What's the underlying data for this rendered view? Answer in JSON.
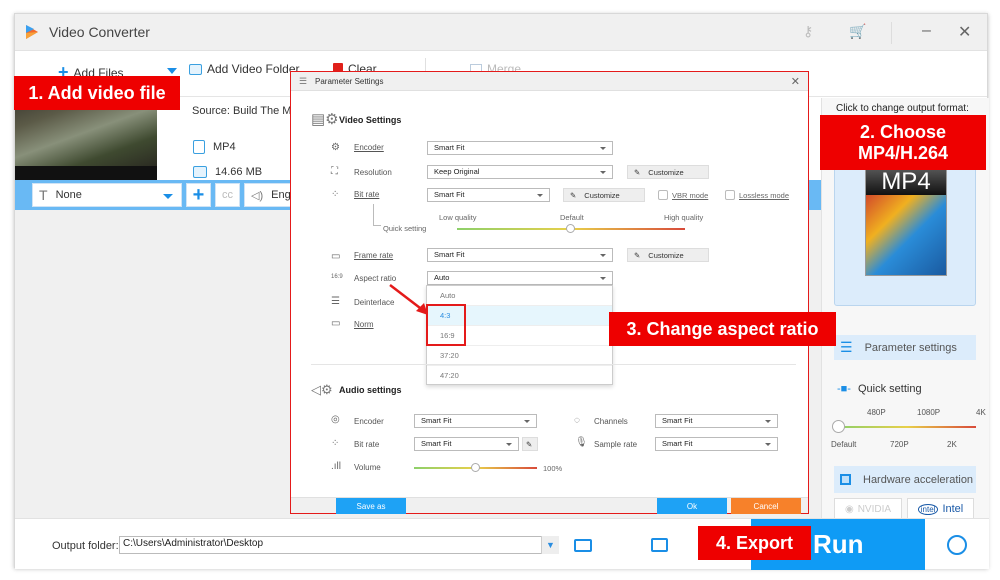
{
  "app": {
    "title": "Video Converter"
  },
  "toolbar": {
    "add_files": "Add Files",
    "add_folder": "Add Video Folder",
    "clear": "Clear",
    "merge": "Merge"
  },
  "file": {
    "source": "Source: Build The Mos",
    "format": "MP4",
    "size": "14.66 MB",
    "subtitle": "None",
    "audio_track": "Eng"
  },
  "right_panel": {
    "format_label": "Click to change output format:",
    "format_name": "MP4",
    "parameter_settings": "Parameter settings",
    "quick_setting": "Quick setting",
    "quick_ticks_top": [
      "480P",
      "1080P",
      "4K"
    ],
    "quick_ticks_bottom": [
      "Default",
      "720P",
      "2K"
    ],
    "quick_value": "Default",
    "hw_accel": "Hardware acceleration",
    "gpu_nvidia": "NVIDIA",
    "gpu_intel": "Intel"
  },
  "bottom": {
    "output_label": "Output folder:",
    "output_path": "C:\\Users\\Administrator\\Desktop",
    "run": "Run"
  },
  "dialog": {
    "title": "Parameter Settings",
    "video_section": "Video Settings",
    "encoder_label": "Encoder",
    "encoder_value": "Smart Fit",
    "resolution_label": "Resolution",
    "resolution_value": "Keep Original",
    "bitrate_label": "Bit rate",
    "bitrate_value": "Smart Fit",
    "customize": "Customize",
    "vbr_mode": "VBR mode",
    "lossless_mode": "Lossless mode",
    "quick_setting": "Quick setting",
    "quality_low": "Low quality",
    "quality_default": "Default",
    "quality_high": "High quality",
    "framerate_label": "Frame rate",
    "framerate_value": "Smart Fit",
    "aspect_label": "Aspect ratio",
    "aspect_value": "Auto",
    "deinterlace_label": "Deinterlace",
    "norm_label": "Norm",
    "aspect_options": [
      "Auto",
      "4:3",
      "16:9",
      "37:20",
      "47:20"
    ],
    "aspect_highlighted": "4:3",
    "audio_section": "Audio settings",
    "a_encoder_label": "Encoder",
    "a_encoder_value": "Smart Fit",
    "a_bitrate_label": "Bit rate",
    "a_bitrate_value": "Smart Fit",
    "volume_label": "Volume",
    "volume_value": "100%",
    "channels_label": "Channels",
    "channels_value": "Smart Fit",
    "samplerate_label": "Sample rate",
    "samplerate_value": "Smart Fit",
    "save_as": "Save as",
    "ok": "Ok",
    "cancel": "Cancel"
  },
  "annotations": {
    "step1": "1. Add video file",
    "step2": "2. Choose MP4/H.264",
    "step3": "3. Change aspect ratio",
    "step4": "4. Export"
  },
  "colors": {
    "accent": "#0f9bf5",
    "annotation": "#ee0000",
    "cancel": "#f7812a"
  }
}
